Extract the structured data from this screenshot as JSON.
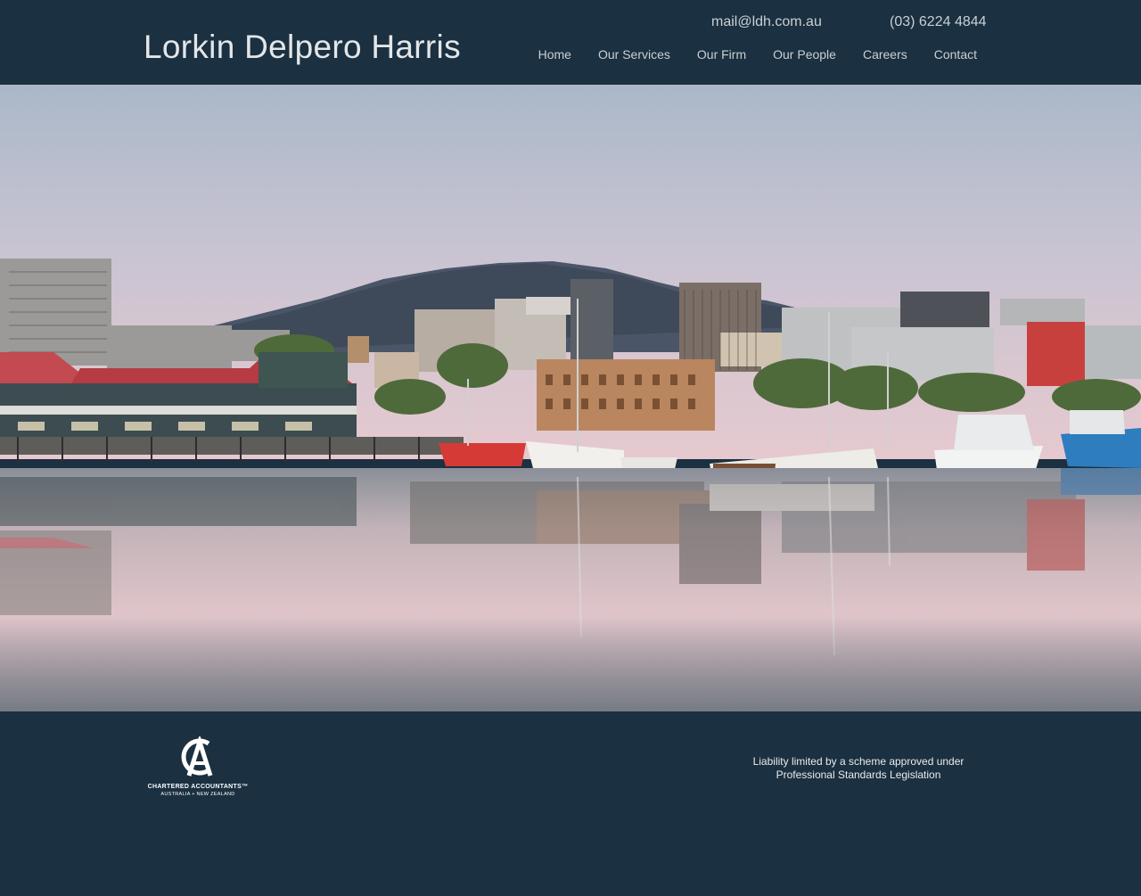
{
  "brand": {
    "name": "Lorkin Delpero Harris"
  },
  "contact": {
    "email": "mail@ldh.com.au",
    "phone": "(03) 6224 4844"
  },
  "nav": {
    "items": [
      "Home",
      "Our Services",
      "Our Firm",
      "Our People",
      "Careers",
      "Contact"
    ]
  },
  "hero": {
    "image": "harbour-waterfront-photo"
  },
  "footer": {
    "logo": {
      "line1": "CHARTERED ACCOUNTANTS™",
      "line2": "AUSTRALIA + NEW ZEALAND"
    },
    "liability": {
      "line1": "Liability limited by a scheme approved under",
      "line2": "Professional Standards Legislation"
    }
  },
  "colors": {
    "background": "#1b3040",
    "text": "#c9d0d5",
    "brand_text": "#e3e6e8"
  }
}
